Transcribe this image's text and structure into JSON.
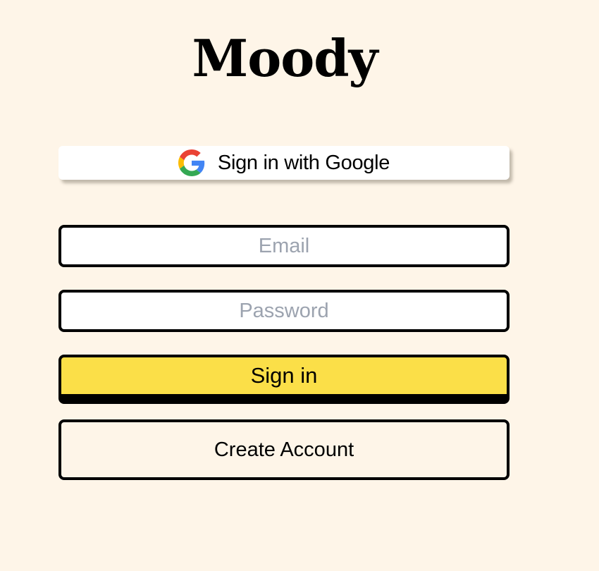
{
  "app": {
    "title": "Moody"
  },
  "google_signin": {
    "label": "Sign in with Google",
    "icon": "google-g-icon"
  },
  "form": {
    "email": {
      "placeholder": "Email",
      "value": ""
    },
    "password": {
      "placeholder": "Password",
      "value": ""
    },
    "signin_label": "Sign in",
    "create_account_label": "Create Account"
  },
  "colors": {
    "background": "#FEF5E8",
    "signin_button": "#FBDF48",
    "border": "#000000",
    "placeholder": "#9CA3AF"
  }
}
